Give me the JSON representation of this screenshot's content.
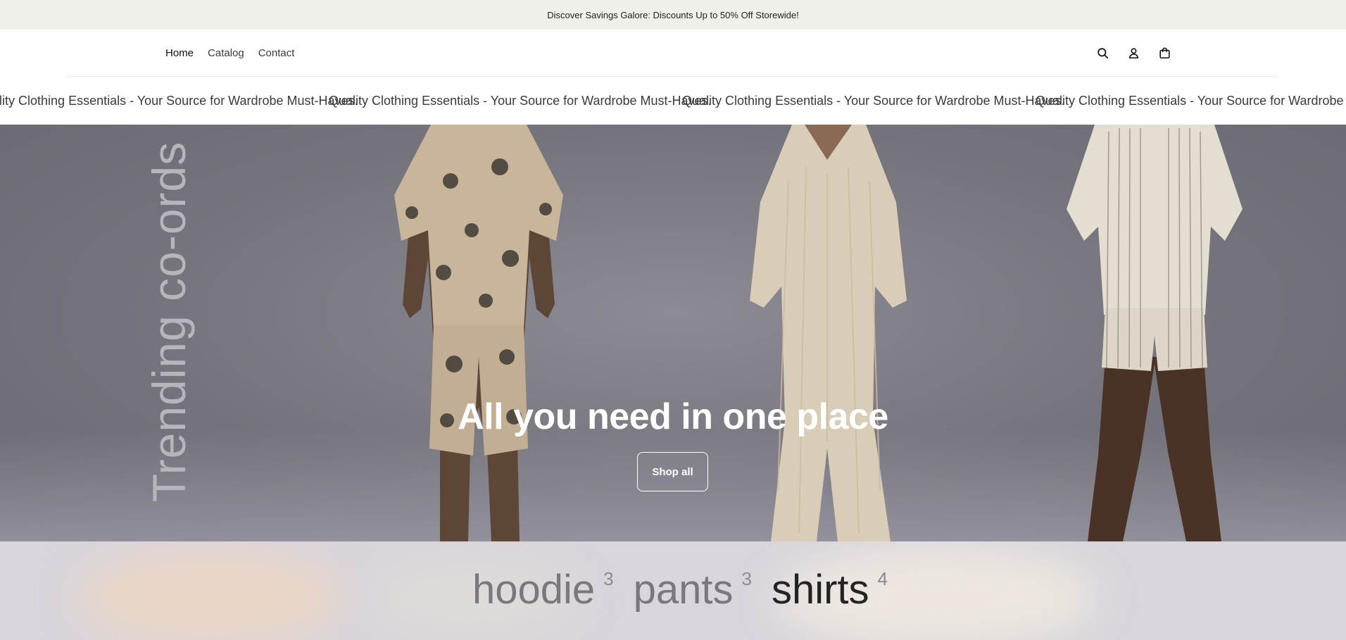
{
  "announcement": {
    "text": "Discover Savings Galore: Discounts Up to 50% Off Storewide!"
  },
  "nav": {
    "items": [
      {
        "label": "Home"
      },
      {
        "label": "Catalog"
      },
      {
        "label": "Contact"
      }
    ]
  },
  "header_icons": [
    "search-icon",
    "account-icon",
    "cart-icon"
  ],
  "marquee": {
    "items": [
      "Quality Clothing Essentials - Your Source for Wardrobe Must-Haves.",
      "Quality Clothing Essentials - Your Source for Wardrobe Must-Haves.",
      "Quality Clothing Essentials - Your Source for Wardrobe Must-Haves.",
      "Quality Clothing Essentials - Your Source for Wardrobe Must-Haves."
    ]
  },
  "hero": {
    "side_text": "Trending co-ords",
    "title": "All you need in one place",
    "button": "Shop all"
  },
  "collections": {
    "items": [
      {
        "name": "hoodie",
        "count": "3"
      },
      {
        "name": "pants",
        "count": "3"
      },
      {
        "name": "shirts",
        "count": "4"
      }
    ]
  }
}
